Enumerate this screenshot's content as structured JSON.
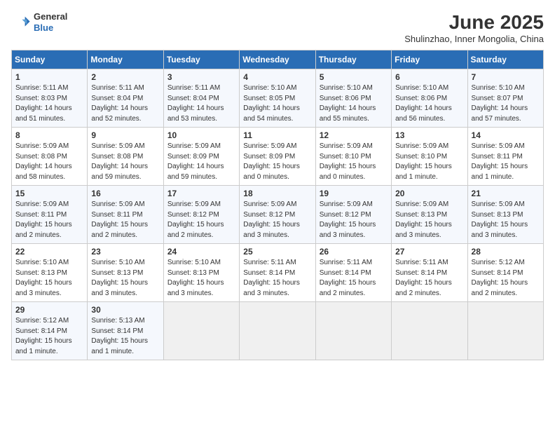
{
  "header": {
    "logo_general": "General",
    "logo_blue": "Blue",
    "month_year": "June 2025",
    "location": "Shulinzhao, Inner Mongolia, China"
  },
  "calendar": {
    "days_of_week": [
      "Sunday",
      "Monday",
      "Tuesday",
      "Wednesday",
      "Thursday",
      "Friday",
      "Saturday"
    ],
    "weeks": [
      [
        {
          "day": "",
          "empty": true
        },
        {
          "day": "",
          "empty": true
        },
        {
          "day": "",
          "empty": true
        },
        {
          "day": "",
          "empty": true
        },
        {
          "day": "",
          "empty": true
        },
        {
          "day": "",
          "empty": true
        },
        {
          "day": "",
          "empty": true
        }
      ],
      [
        {
          "day": "1",
          "sunrise": "5:11 AM",
          "sunset": "8:03 PM",
          "daylight": "14 hours and 51 minutes."
        },
        {
          "day": "2",
          "sunrise": "5:11 AM",
          "sunset": "8:04 PM",
          "daylight": "14 hours and 52 minutes."
        },
        {
          "day": "3",
          "sunrise": "5:11 AM",
          "sunset": "8:04 PM",
          "daylight": "14 hours and 53 minutes."
        },
        {
          "day": "4",
          "sunrise": "5:10 AM",
          "sunset": "8:05 PM",
          "daylight": "14 hours and 54 minutes."
        },
        {
          "day": "5",
          "sunrise": "5:10 AM",
          "sunset": "8:06 PM",
          "daylight": "14 hours and 55 minutes."
        },
        {
          "day": "6",
          "sunrise": "5:10 AM",
          "sunset": "8:06 PM",
          "daylight": "14 hours and 56 minutes."
        },
        {
          "day": "7",
          "sunrise": "5:10 AM",
          "sunset": "8:07 PM",
          "daylight": "14 hours and 57 minutes."
        }
      ],
      [
        {
          "day": "8",
          "sunrise": "5:09 AM",
          "sunset": "8:08 PM",
          "daylight": "14 hours and 58 minutes."
        },
        {
          "day": "9",
          "sunrise": "5:09 AM",
          "sunset": "8:08 PM",
          "daylight": "14 hours and 59 minutes."
        },
        {
          "day": "10",
          "sunrise": "5:09 AM",
          "sunset": "8:09 PM",
          "daylight": "14 hours and 59 minutes."
        },
        {
          "day": "11",
          "sunrise": "5:09 AM",
          "sunset": "8:09 PM",
          "daylight": "15 hours and 0 minutes."
        },
        {
          "day": "12",
          "sunrise": "5:09 AM",
          "sunset": "8:10 PM",
          "daylight": "15 hours and 0 minutes."
        },
        {
          "day": "13",
          "sunrise": "5:09 AM",
          "sunset": "8:10 PM",
          "daylight": "15 hours and 1 minute."
        },
        {
          "day": "14",
          "sunrise": "5:09 AM",
          "sunset": "8:11 PM",
          "daylight": "15 hours and 1 minute."
        }
      ],
      [
        {
          "day": "15",
          "sunrise": "5:09 AM",
          "sunset": "8:11 PM",
          "daylight": "15 hours and 2 minutes."
        },
        {
          "day": "16",
          "sunrise": "5:09 AM",
          "sunset": "8:11 PM",
          "daylight": "15 hours and 2 minutes."
        },
        {
          "day": "17",
          "sunrise": "5:09 AM",
          "sunset": "8:12 PM",
          "daylight": "15 hours and 2 minutes."
        },
        {
          "day": "18",
          "sunrise": "5:09 AM",
          "sunset": "8:12 PM",
          "daylight": "15 hours and 3 minutes."
        },
        {
          "day": "19",
          "sunrise": "5:09 AM",
          "sunset": "8:12 PM",
          "daylight": "15 hours and 3 minutes."
        },
        {
          "day": "20",
          "sunrise": "5:09 AM",
          "sunset": "8:13 PM",
          "daylight": "15 hours and 3 minutes."
        },
        {
          "day": "21",
          "sunrise": "5:09 AM",
          "sunset": "8:13 PM",
          "daylight": "15 hours and 3 minutes."
        }
      ],
      [
        {
          "day": "22",
          "sunrise": "5:10 AM",
          "sunset": "8:13 PM",
          "daylight": "15 hours and 3 minutes."
        },
        {
          "day": "23",
          "sunrise": "5:10 AM",
          "sunset": "8:13 PM",
          "daylight": "15 hours and 3 minutes."
        },
        {
          "day": "24",
          "sunrise": "5:10 AM",
          "sunset": "8:13 PM",
          "daylight": "15 hours and 3 minutes."
        },
        {
          "day": "25",
          "sunrise": "5:11 AM",
          "sunset": "8:14 PM",
          "daylight": "15 hours and 3 minutes."
        },
        {
          "day": "26",
          "sunrise": "5:11 AM",
          "sunset": "8:14 PM",
          "daylight": "15 hours and 2 minutes."
        },
        {
          "day": "27",
          "sunrise": "5:11 AM",
          "sunset": "8:14 PM",
          "daylight": "15 hours and 2 minutes."
        },
        {
          "day": "28",
          "sunrise": "5:12 AM",
          "sunset": "8:14 PM",
          "daylight": "15 hours and 2 minutes."
        }
      ],
      [
        {
          "day": "29",
          "sunrise": "5:12 AM",
          "sunset": "8:14 PM",
          "daylight": "15 hours and 1 minute."
        },
        {
          "day": "30",
          "sunrise": "5:13 AM",
          "sunset": "8:14 PM",
          "daylight": "15 hours and 1 minute."
        },
        {
          "day": "",
          "empty": true
        },
        {
          "day": "",
          "empty": true
        },
        {
          "day": "",
          "empty": true
        },
        {
          "day": "",
          "empty": true
        },
        {
          "day": "",
          "empty": true
        }
      ]
    ]
  }
}
